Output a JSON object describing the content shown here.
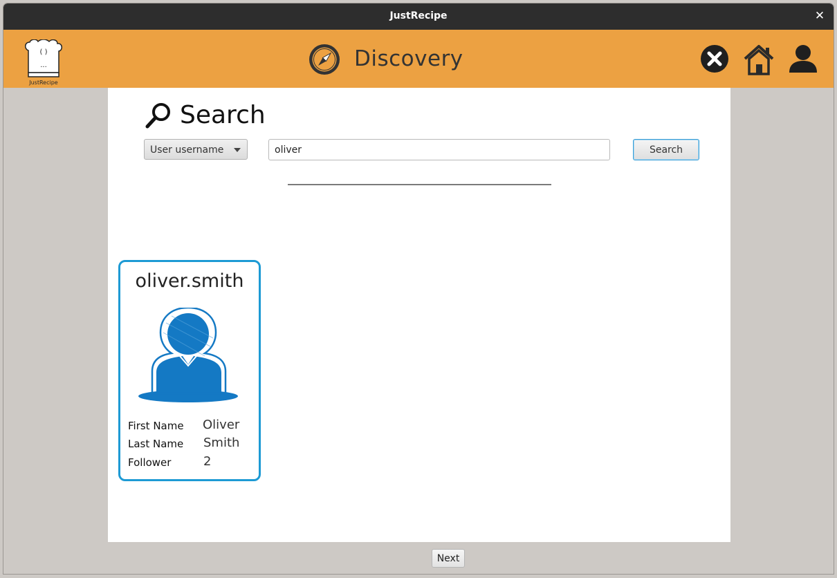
{
  "window": {
    "title": "JustRecipe",
    "close_glyph": "✕"
  },
  "header": {
    "logo_caption": "JustRecipe",
    "logo_face": "( )",
    "logo_dots": "...",
    "title": "Discovery",
    "icons": [
      "compass-icon",
      "close-circle-icon",
      "home-icon",
      "user-icon"
    ]
  },
  "search": {
    "heading": "Search",
    "filter_selected": "User username",
    "query": "oliver",
    "button_label": "Search"
  },
  "results": [
    {
      "username": "oliver.smith",
      "first_name_label": "First Name",
      "first_name": "Oliver",
      "last_name_label": "Last Name",
      "last_name": "Smith",
      "follower_label": "Follower",
      "follower": "2"
    }
  ],
  "pagination": {
    "next_label": "Next"
  },
  "colors": {
    "header_bg": "#eca142",
    "titlebar_bg": "#2d2d2d",
    "card_border": "#1d9ad4",
    "avatar_blue": "#1479c4",
    "page_bg": "#cdc9c5"
  }
}
